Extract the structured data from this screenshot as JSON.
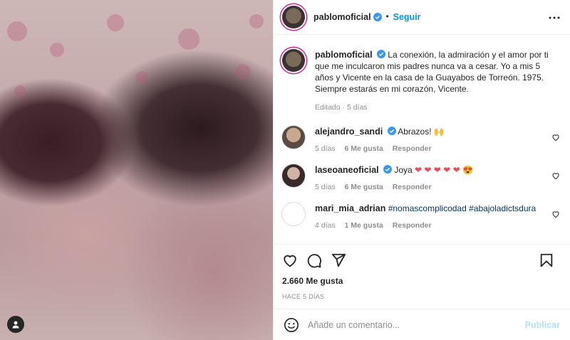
{
  "post": {
    "username": "pablomoficial",
    "follow_label": "Seguir",
    "caption": "La conexión, la admiración y el amor por ti que me inculcaron mis padres nunca va a cesar. Yo a mis 5 años y Vicente en la casa de la Guayabos de Torreón. 1975. Siempre estarás en mi corazón, Vicente.",
    "caption_meta": "Editado · 5 días"
  },
  "comments": [
    {
      "username": "alejandro_sandi",
      "text": "Abrazos! 🙌",
      "time": "5 días",
      "likes": "6 Me gusta",
      "reply": "Responder"
    },
    {
      "username": "laseoaneoficial",
      "text": "Joya",
      "hearts": "❤ ❤ ❤ ❤ ❤",
      "extra_emoji": "😍",
      "time": "5 días",
      "likes": "6 Me gusta",
      "reply": "Responder"
    },
    {
      "username": "mari_mia_adrian",
      "tags": "#nomascomplicodad #abajoladictsdura",
      "time": "4 días",
      "likes": "1 Me gusta",
      "reply": "Responder"
    }
  ],
  "stats": {
    "likes": "2.660 Me gusta",
    "ago": "HACE 5 DÍAS"
  },
  "comment_box": {
    "placeholder": "Añade un comentario...",
    "publish_label": "Publicar"
  },
  "colors": {
    "accent": "#0095f6",
    "publish_disabled": "#b2dffc",
    "verified": "#3897f0",
    "heart": "#ed4956"
  },
  "icons": [
    "user-tag-icon",
    "verified-icon",
    "more-icon",
    "heart-icon",
    "comment-icon",
    "share-icon",
    "save-icon",
    "emoji-icon"
  ]
}
